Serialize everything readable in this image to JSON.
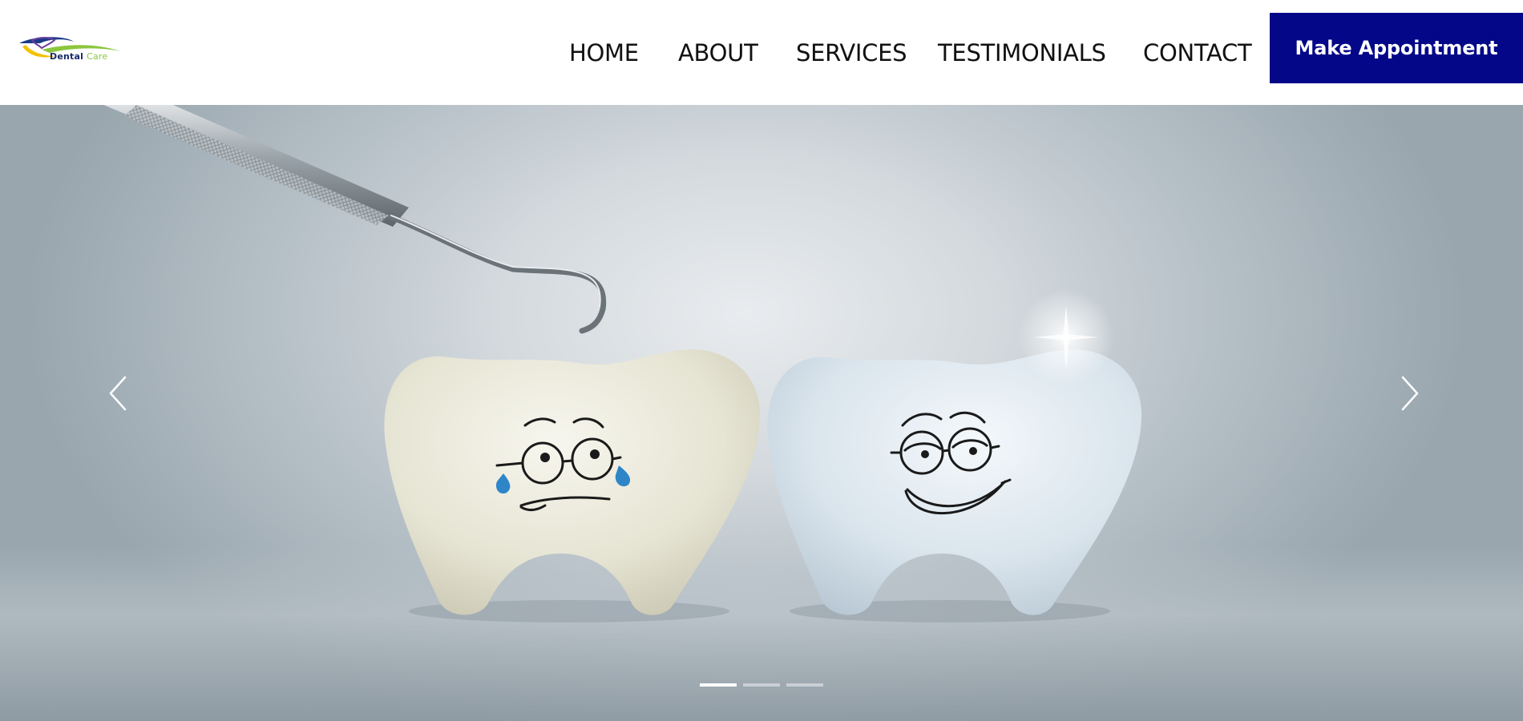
{
  "header": {
    "logo": {
      "text_primary": "Dental",
      "text_secondary": "Care",
      "icon": "tooth-swoosh-logo"
    },
    "nav": {
      "items": [
        {
          "label": "HOME"
        },
        {
          "label": "ABOUT"
        },
        {
          "label": "SERVICES"
        },
        {
          "label": "TESTIMONIALS"
        },
        {
          "label": "CONTACT"
        }
      ]
    },
    "cta_label": "Make Appointment"
  },
  "hero": {
    "image": "two-cartoon-teeth-sad-and-happy-with-dental-probe",
    "prev_icon": "chevron-left-icon",
    "next_icon": "chevron-right-icon",
    "slides_total": 3,
    "active_slide": 1
  },
  "colors": {
    "accent": "#030788",
    "nav_text": "#111111",
    "indicator_active": "#ffffff",
    "indicator_inactive": "#c9cfd4"
  }
}
